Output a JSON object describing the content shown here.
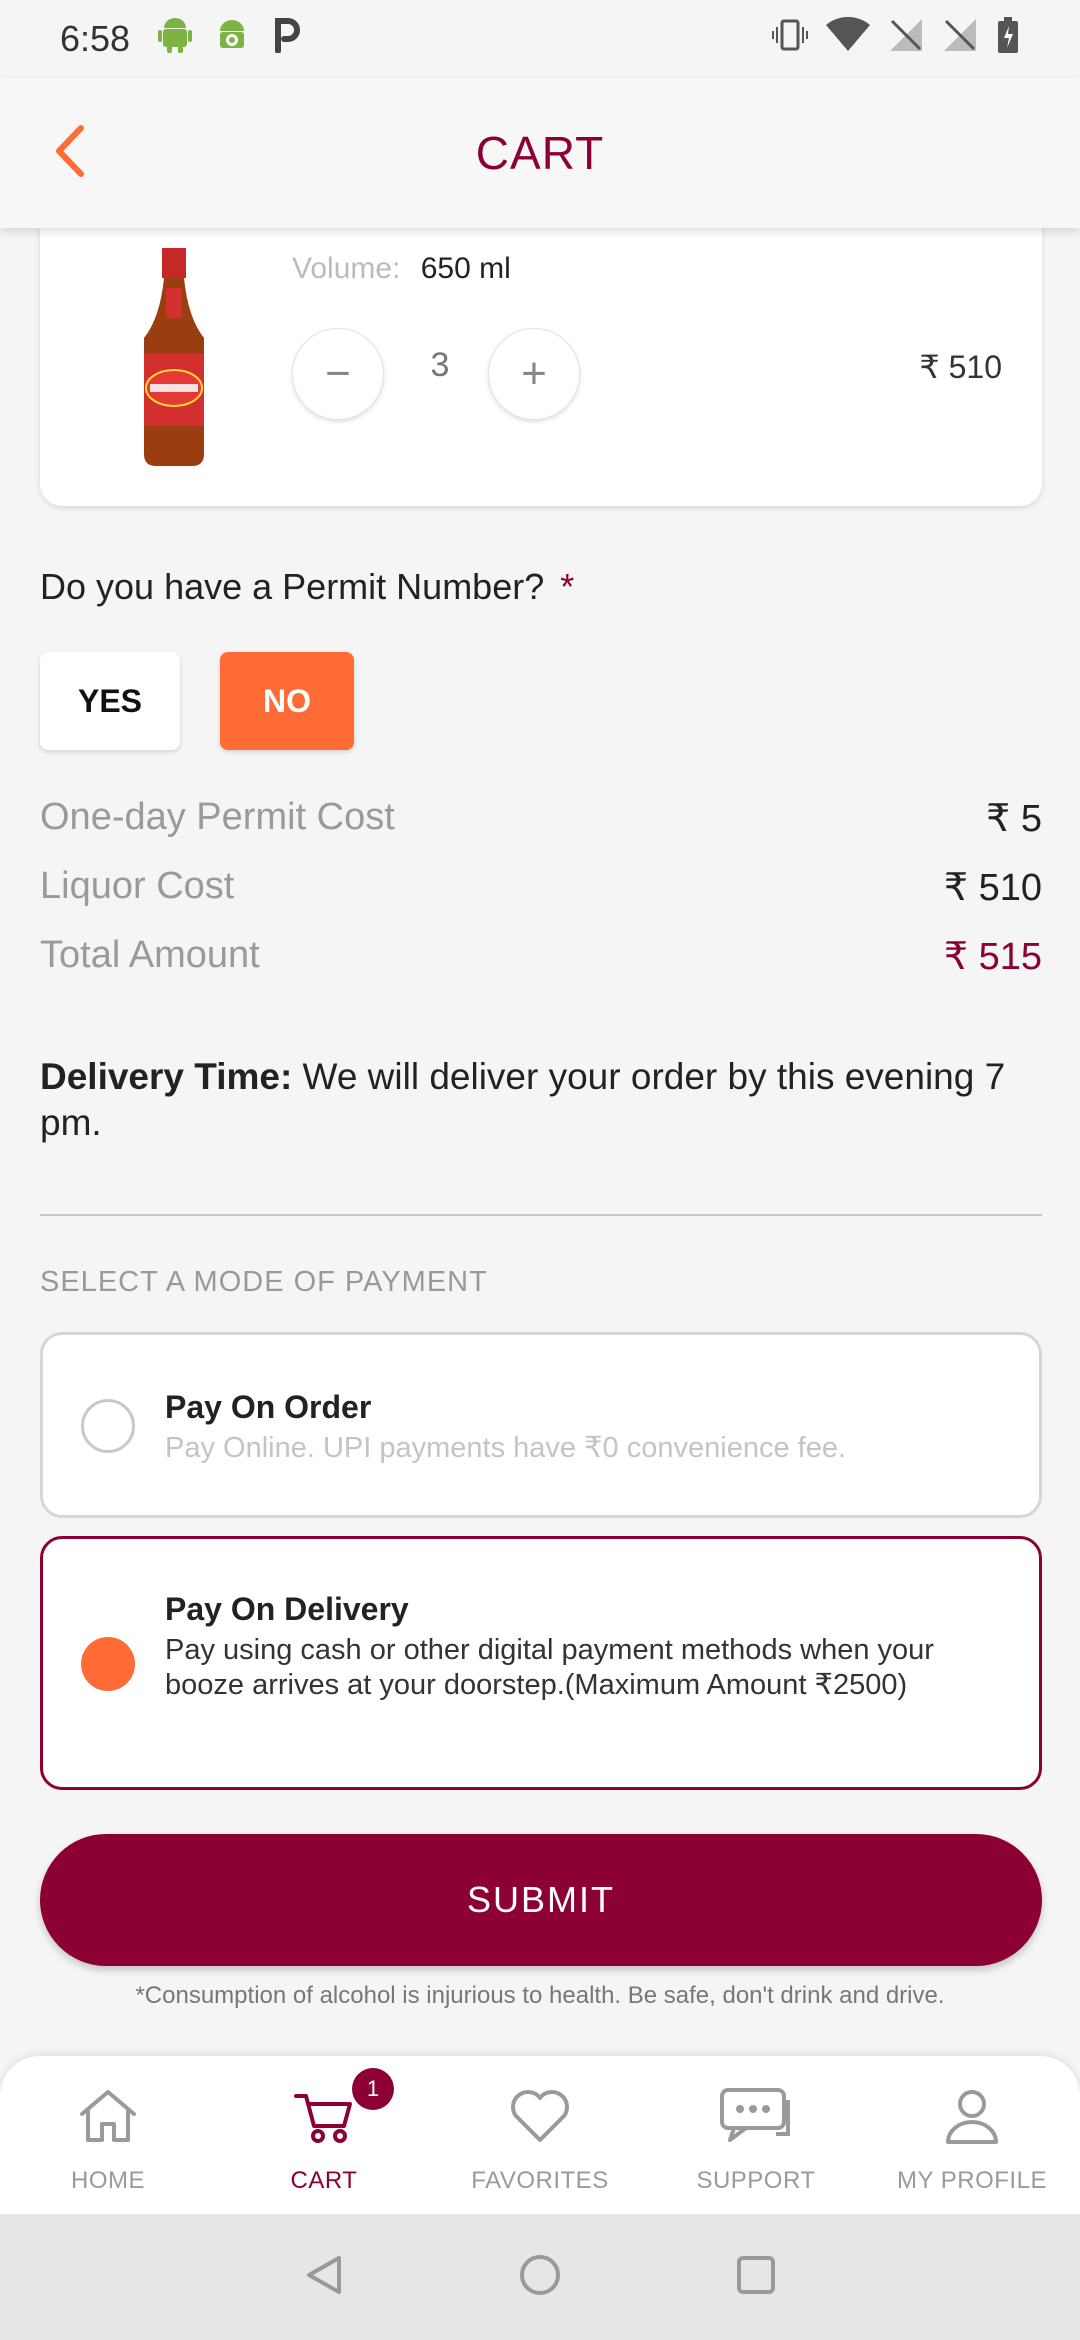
{
  "status_bar": {
    "time": "6:58"
  },
  "header": {
    "title": "CART",
    "back_icon": "chevron-left-icon"
  },
  "cart_item": {
    "volume_label": "Volume:",
    "volume_value": "650 ml",
    "quantity": "3",
    "decrease_symbol": "−",
    "increase_symbol": "+",
    "price": "₹ 510",
    "image": "beer-bottle"
  },
  "permit": {
    "question": "Do you have a Permit Number?",
    "required_marker": "*",
    "yes_label": "YES",
    "no_label": "NO",
    "selected": "NO"
  },
  "costs": {
    "permit_cost_label": "One-day Permit Cost",
    "permit_cost_value": "₹ 5",
    "liquor_cost_label": "Liquor Cost",
    "liquor_cost_value": "₹ 510",
    "total_label": "Total Amount",
    "total_value": "₹ 515"
  },
  "delivery": {
    "label": "Delivery Time:",
    "text": " We will deliver your order by this evening 7 pm."
  },
  "payment": {
    "heading": "SELECT A MODE OF PAYMENT",
    "options": [
      {
        "title": "Pay On Order",
        "description": "Pay Online. UPI payments have ₹0 convenience fee.",
        "selected": false
      },
      {
        "title": "Pay On Delivery",
        "description": "Pay using cash or other digital payment methods when your booze arrives at your doorstep.(Maximum Amount ₹2500)",
        "selected": true
      }
    ]
  },
  "submit_label": "SUBMIT",
  "disclaimer": "*Consumption of alcohol is injurious to health. Be safe, don't drink and drive.",
  "bottom_nav": {
    "items": [
      {
        "label": "HOME",
        "icon": "home-icon"
      },
      {
        "label": "CART",
        "icon": "cart-icon",
        "badge": "1",
        "active": true
      },
      {
        "label": "FAVORITES",
        "icon": "heart-icon"
      },
      {
        "label": "SUPPORT",
        "icon": "chat-icon"
      },
      {
        "label": "MY PROFILE",
        "icon": "profile-icon"
      }
    ]
  },
  "colors": {
    "brand": "#8c0033",
    "accent": "#ff6b35"
  }
}
